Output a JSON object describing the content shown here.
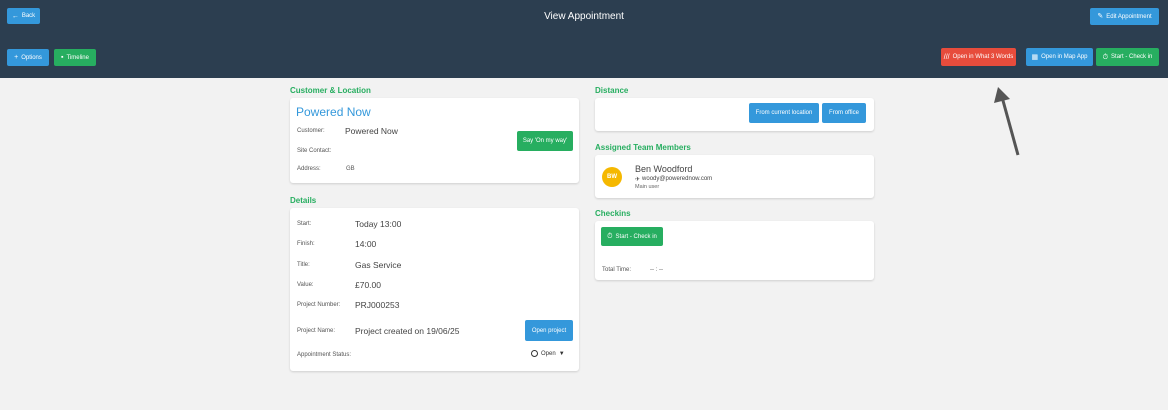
{
  "header": {
    "title": "View Appointment",
    "back_label": "Back",
    "edit_label": "Edit Appointment",
    "options_label": "Options",
    "timeline_label": "Timeline",
    "what3words_label": "Open in What 3 Words",
    "map_app_label": "Open in Map App",
    "start_checkin_label": "Start - Check in"
  },
  "customer_location": {
    "section_title": "Customer & Location",
    "name": "Powered Now",
    "customer_label": "Customer:",
    "customer_value": "Powered Now",
    "site_contact_label": "Site Contact:",
    "site_contact_value": "",
    "address_label": "Address:",
    "address_value": "GB",
    "on_my_way_label": "Say 'On my way'"
  },
  "details": {
    "section_title": "Details",
    "start_label": "Start:",
    "start_value": "Today 13:00",
    "finish_label": "Finish:",
    "finish_value": "14:00",
    "title_label": "Title:",
    "title_value": "Gas Service",
    "value_label": "Value:",
    "value_value": "£70.00",
    "project_number_label": "Project Number:",
    "project_number_value": "PRJ000253",
    "project_name_label": "Project Name:",
    "project_name_value": "Project created on 19/06/25",
    "open_project_label": "Open project",
    "status_label": "Appointment Status:",
    "status_value": "Open"
  },
  "distance": {
    "section_title": "Distance",
    "from_current_label": "From current location",
    "from_office_label": "From office"
  },
  "team": {
    "section_title": "Assigned Team Members",
    "initials": "BW",
    "name": "Ben Woodford",
    "email": "woody@powerednow.com",
    "role": "Main user"
  },
  "checkins": {
    "section_title": "Checkins",
    "start_label": "Start - Check in",
    "total_time_label": "Total Time:",
    "total_time_value": "-- : --"
  },
  "colors": {
    "header_bg": "#2c3e50",
    "accent_blue": "#3498db",
    "accent_green": "#27ae60",
    "accent_red": "#e74c3c",
    "avatar": "#f5b800"
  }
}
